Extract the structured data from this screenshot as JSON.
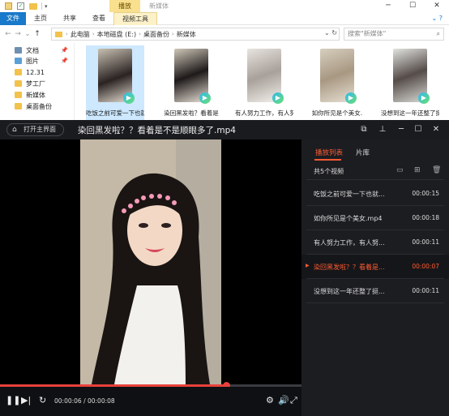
{
  "explorer": {
    "window_title": "新媒体",
    "context_tab": "播放",
    "ribbon_tabs": [
      "文件",
      "主页",
      "共享",
      "查看",
      "视频工具"
    ],
    "breadcrumb": [
      "此电脑",
      "本地磁盘 (E:)",
      "桌面备份",
      "新媒体"
    ],
    "search_placeholder": "搜索\"新媒体\"",
    "nav_items": [
      {
        "label": "文档",
        "icon": "documents-icon",
        "pinned": true
      },
      {
        "label": "图片",
        "icon": "pictures-icon",
        "pinned": true
      },
      {
        "label": "12.31",
        "icon": "folder-icon",
        "pinned": false
      },
      {
        "label": "梦工厂",
        "icon": "folder-icon",
        "pinned": false
      },
      {
        "label": "新媒体",
        "icon": "folder-icon",
        "pinned": false
      },
      {
        "label": "桌面备份",
        "icon": "folder-icon",
        "pinned": false
      }
    ],
    "files": [
      {
        "label": "吃饭之前可爱一下也就",
        "selected": true
      },
      {
        "label": "染回黑发啦？看着是",
        "selected": false
      },
      {
        "label": "有人努力工作，有人努",
        "selected": false
      },
      {
        "label": "如你所见是个美女.",
        "selected": false
      },
      {
        "label": "没想到这一年还整了挺",
        "selected": false
      }
    ]
  },
  "player": {
    "open_main_label": "打开主界面",
    "title": "染回黑发啦？？看着是不是顺眼多了.mp4",
    "time_current": "00:00:06",
    "time_total": "00:00:08",
    "progress": 0.75,
    "tabs": [
      "播放列表",
      "片库"
    ],
    "active_tab": "播放列表",
    "count_label": "共5个视频",
    "playlist": [
      {
        "name": "吃饭之前可爱一下也就...",
        "duration": "00:00:15",
        "active": false
      },
      {
        "name": "如你所见是个美女.mp4",
        "duration": "00:00:18",
        "active": false
      },
      {
        "name": "有人努力工作，有人努...",
        "duration": "00:00:11",
        "active": false
      },
      {
        "name": "染回黑发啦？？看着是...",
        "duration": "00:00:07",
        "active": true
      },
      {
        "name": "没想到这一年还整了挺...",
        "duration": "00:00:11",
        "active": false
      }
    ],
    "accent_color": "#ff5b33",
    "progress_color": "#e8413b"
  }
}
